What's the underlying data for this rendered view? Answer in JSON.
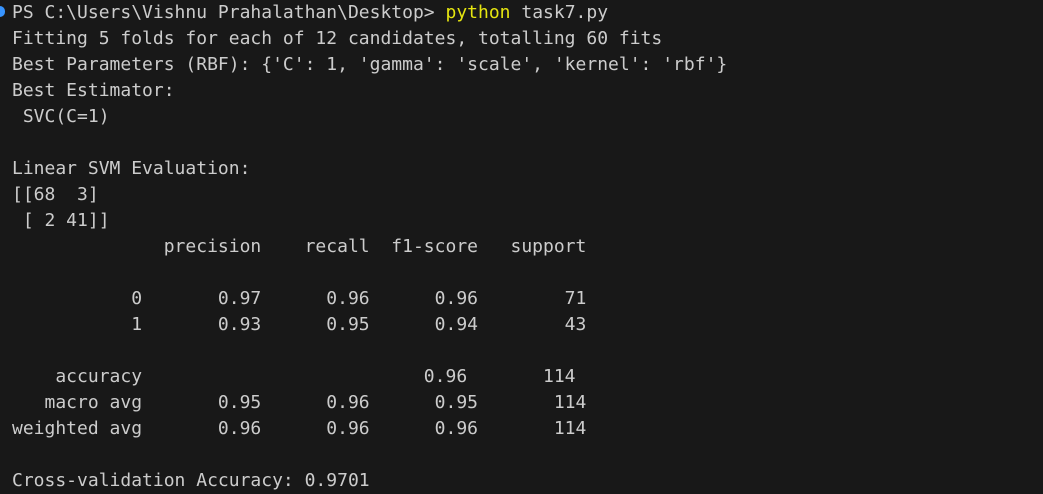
{
  "terminal": {
    "prompt": "PS C:\\Users\\Vishnu Prahalathan\\Desktop> ",
    "command": "python",
    "command_args": " task7.py",
    "output": [
      "Fitting 5 folds for each of 12 candidates, totalling 60 fits",
      "Best Parameters (RBF): {'C': 1, 'gamma': 'scale', 'kernel': 'rbf'}",
      "Best Estimator:",
      " SVC(C=1)",
      "",
      "Linear SVM Evaluation:",
      "[[68  3]",
      " [ 2 41]]",
      "              precision    recall  f1-score   support",
      "",
      "           0       0.97      0.96      0.96        71",
      "           1       0.93      0.95      0.94        43",
      "",
      "    accuracy                          0.96       114",
      "   macro avg       0.95      0.96      0.95       114",
      "weighted avg       0.96      0.96      0.96       114",
      "",
      "Cross-validation Accuracy: 0.9701"
    ],
    "colors": {
      "background": "#181818",
      "text": "#cccccc",
      "command": "#e5e510",
      "prompt_marker": "#3794ff"
    }
  }
}
